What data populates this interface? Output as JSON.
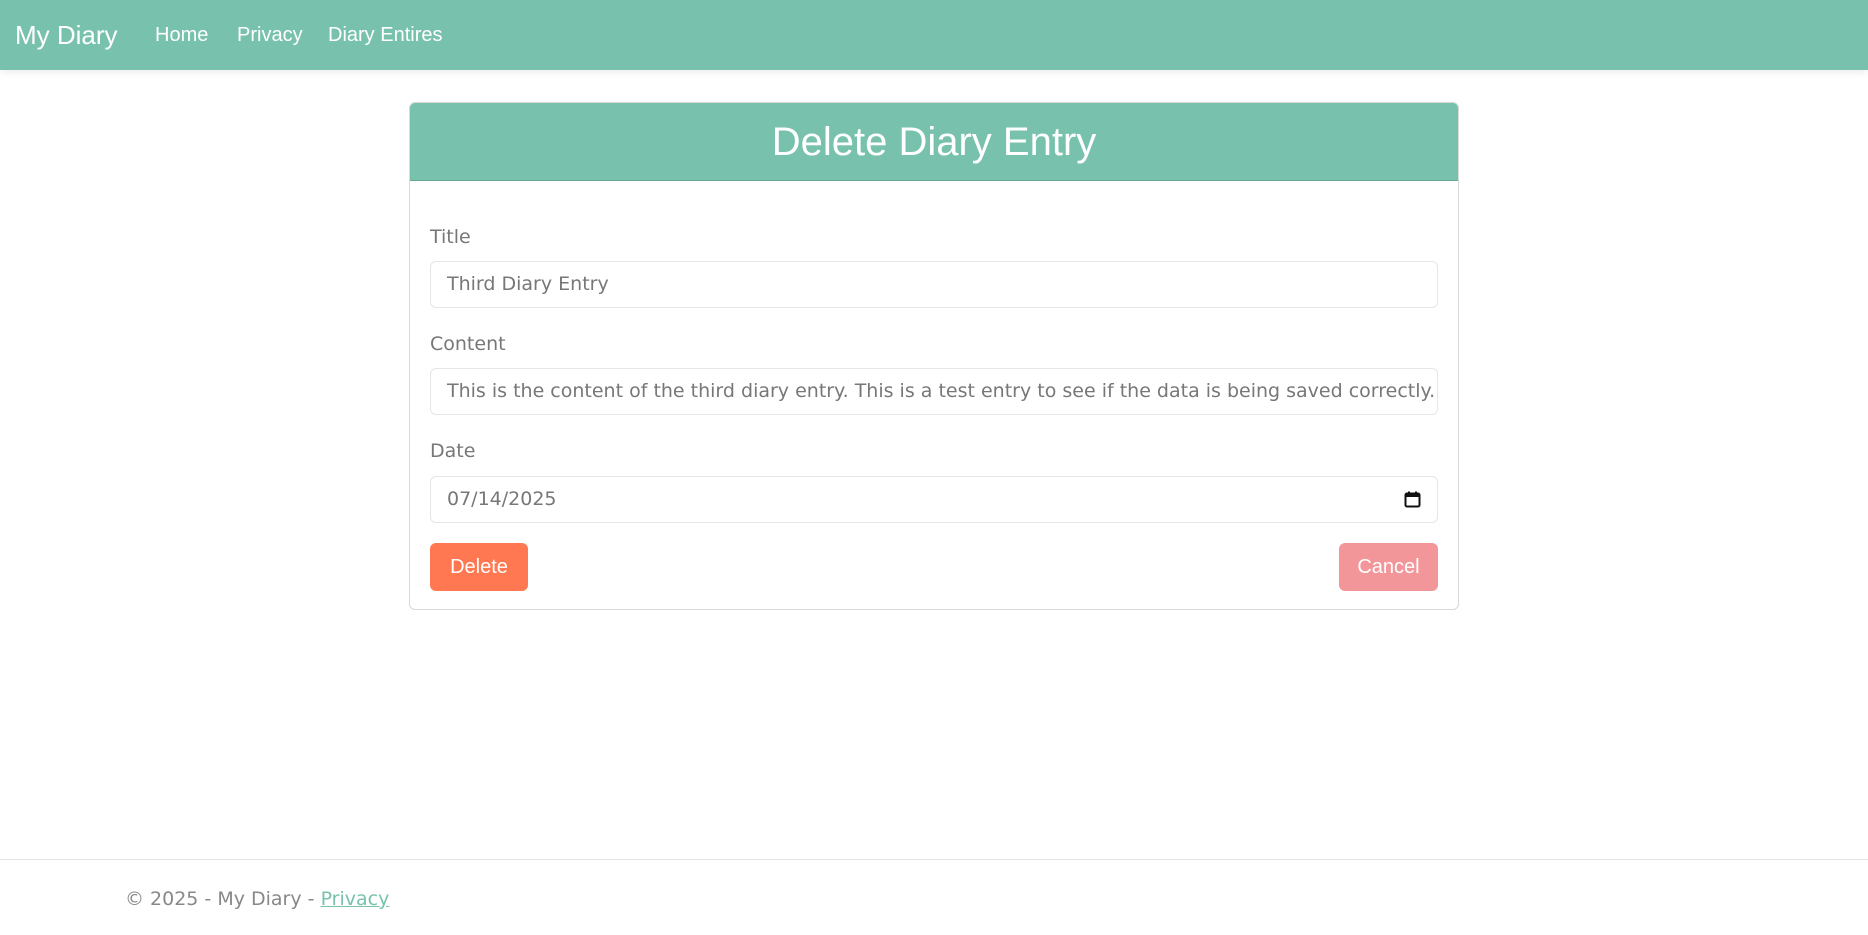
{
  "navbar": {
    "brand": "My Diary",
    "links": [
      {
        "label": "Home"
      },
      {
        "label": "Privacy"
      },
      {
        "label": "Diary Entires"
      }
    ]
  },
  "card": {
    "header": "Delete Diary Entry",
    "fields": {
      "title": {
        "label": "Title",
        "value": "Third Diary Entry"
      },
      "content": {
        "label": "Content",
        "value": "This is the content of the third diary entry. This is a test entry to see if the data is being saved correctly."
      },
      "date": {
        "label": "Date",
        "value": "07/14/2025"
      }
    },
    "buttons": {
      "delete": "Delete",
      "cancel": "Cancel"
    }
  },
  "footer": {
    "text": "© 2025 - My Diary - ",
    "privacy_link": "Privacy"
  },
  "colors": {
    "primary": "#78c2ad",
    "danger": "#ff7851",
    "secondary": "#f3969a"
  },
  "icons": {
    "date": "calendar-icon"
  }
}
